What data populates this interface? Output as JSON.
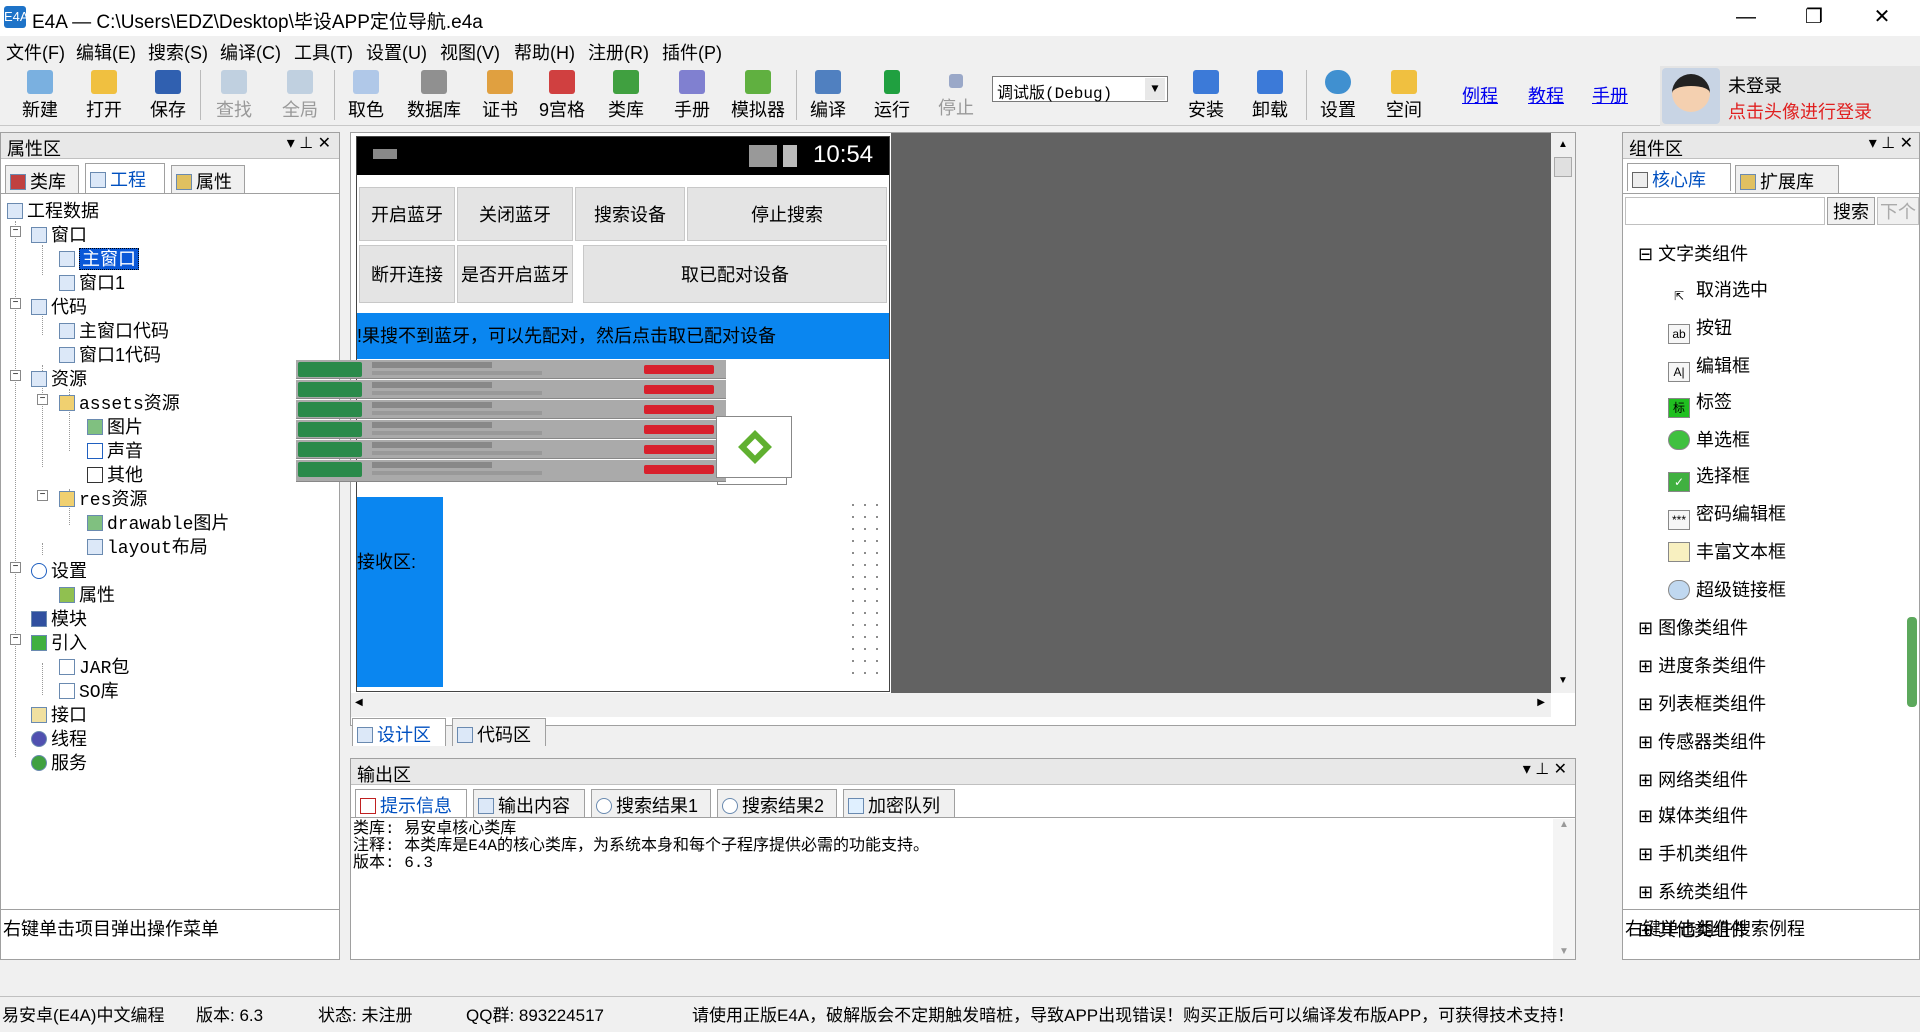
{
  "window": {
    "title": "E4A — C:\\Users\\EDZ\\Desktop\\毕设APP定位导航.e4a",
    "app_icon": "E4A",
    "minimize": "—",
    "maximize": "❐",
    "close": "✕"
  },
  "menu": [
    "文件(F)",
    "编辑(E)",
    "搜索(S)",
    "编译(C)",
    "工具(T)",
    "设置(U)",
    "视图(V)",
    "帮助(H)",
    "注册(R)",
    "插件(P)"
  ],
  "toolbar": {
    "new": "新建",
    "open": "打开",
    "save": "保存",
    "find": "查找",
    "global": "全局",
    "color": "取色",
    "database": "数据库",
    "cert": "证书",
    "grid9": "9宫格",
    "lib": "类库",
    "manual": "手册",
    "emulator": "模拟器",
    "compile": "编译",
    "run": "运行",
    "stop": "停止",
    "mode": "调试版(Debug)",
    "install": "安装",
    "uninstall": "卸载",
    "settings": "设置",
    "space": "空间",
    "link_examples": "例程",
    "link_tutorial": "教程",
    "link_manual": "手册",
    "user_status": "未登录",
    "login_hint": "点击头像进行登录"
  },
  "left_panel": {
    "title": "属性区",
    "tabs": [
      "类库",
      "工程",
      "属性"
    ],
    "tree": [
      "工程数据",
      "窗口",
      "主窗口",
      "窗口1",
      "代码",
      "主窗口代码",
      "窗口1代码",
      "资源",
      "assets资源",
      "图片",
      "声音",
      "其他",
      "res资源",
      "drawable图片",
      "layout布局",
      "设置",
      "属性",
      "模块",
      "引入",
      "JAR包",
      "SO库",
      "接口",
      "线程",
      "服务"
    ],
    "footer": "右键单击项目弹出操作菜单"
  },
  "phone": {
    "time": "10:54",
    "btn_open_bt": "开启蓝牙",
    "btn_close_bt": "关闭蓝牙",
    "btn_search": "搜索设备",
    "btn_stop": "停止搜索",
    "btn_disconnect": "断开连接",
    "btn_is_open": "是否开启蓝牙",
    "btn_paired": "取已配对设备",
    "hint": "!果搜不到蓝牙，可以先配对，然后点击取已配对设备",
    "recv_label": "接收区:"
  },
  "design_tabs": [
    "设计区",
    "代码区"
  ],
  "output": {
    "title": "输出区",
    "tabs": [
      "提示信息",
      "输出内容",
      "搜索结果1",
      "搜索结果2",
      "加密队列"
    ],
    "lines": [
      "类库: 易安卓核心类库",
      "注释: 本类库是E4A的核心类库，为系统本身和每个子程序提供必需的功能支持。",
      "版本: 6.3"
    ]
  },
  "right_panel": {
    "title": "组件区",
    "tabs": [
      "核心库",
      "扩展库"
    ],
    "search_btn": "搜索",
    "next_btn": "下个",
    "groups": [
      "文字类组件",
      "图像类组件",
      "进度条类组件",
      "列表框类组件",
      "传感器类组件",
      "网络类组件",
      "媒体类组件",
      "手机类组件",
      "系统类组件",
      "其他类组件"
    ],
    "text_items": [
      "取消选中",
      "按钮",
      "编辑框",
      "标签",
      "单选框",
      "选择框",
      "密码编辑框",
      "丰富文本框",
      "超级链接框"
    ],
    "footer": "右键单击组件搜索例程"
  },
  "statusbar": {
    "s1": "易安卓(E4A)中文编程",
    "s2": "版本: 6.3",
    "s3": "状态: 未注册",
    "s4": "QQ群: 893224517",
    "s5": "请使用正版E4A，破解版会不定期触发暗桩，导致APP出现错误！购买正版后可以编译发布版APP，可获得技术支持！"
  },
  "icons": [
    "app-icon",
    "new-icon",
    "open-icon",
    "save-icon",
    "find-icon",
    "global-icon",
    "color-picker-icon",
    "database-icon",
    "cert-icon",
    "grid9-icon",
    "lib-icon",
    "manual-icon",
    "emulator-icon",
    "compile-icon",
    "run-icon",
    "stop-icon",
    "install-icon",
    "uninstall-icon",
    "settings-icon",
    "space-icon",
    "avatar"
  ]
}
